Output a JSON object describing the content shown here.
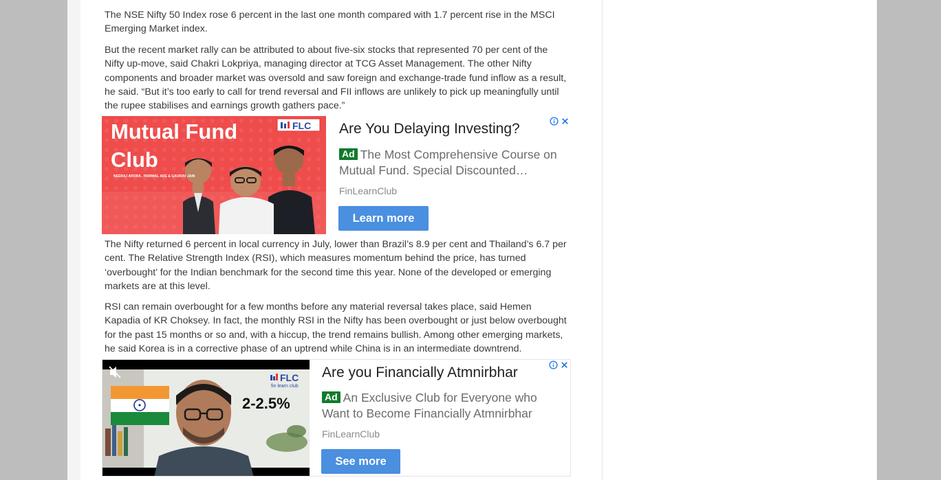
{
  "article": {
    "paragraphs": [
      "The NSE Nifty 50 Index rose 6 percent in the last one month compared with 1.7 percent rise in the MSCI Emerging Market index.",
      "But the recent market rally can be attributed to about five-six stocks that represented 70 per cent of the Nifty up-move, said Chakri Lokpriya, managing director at TCG Asset Management. The other Nifty components and broader market was oversold and saw foreign and exchange-trade fund inflow as a result, he said. “But it’s too early to call for trend reversal and FII inflows are unlikely to pick up meaningfully until the rupee stabilises and earnings growth gathers pace.”",
      "The Nifty returned 6 percent in local currency in July, lower than Brazil’s 8.9 per cent and Thailand’s 6.7 per cent. The Relative Strength Index (RSI), which measures momentum behind the price, has turned ‘overbought’ for the Indian benchmark for the second time this year. None of the developed or emerging markets are at this level.",
      "RSI can remain overbought for a few months before any material reversal takes place, said Hemen Kapadia of KR Choksey. In fact, the monthly RSI in the Nifty has been overbought or just below overbought for the past 15 months or so and, with a hiccup, the trend remains bullish. Among other emerging markets, he said Korea is in a corrective phase of an uptrend while China is in an intermediate downtrend."
    ]
  },
  "ads": [
    {
      "title": "Are You Delaying Investing?",
      "badge": "Ad",
      "description": "The Most Comprehensive Course on Mutual Fund. Special Discounted…",
      "source": "FinLearnClub",
      "cta": "Learn more",
      "image": {
        "headline_line1": "Mutual Fund",
        "headline_line2": "Club",
        "logo": "FLC",
        "names": "NEERAJ ARORA , PARIMAL ADE & GAURAV JAIN"
      }
    },
    {
      "title": "Are you Financially Atmnirbhar",
      "badge": "Ad",
      "description": "An Exclusive Club for Everyone who Want to Become Financially Atmnirbhar",
      "source": "FinLearnClub",
      "cta": "See more",
      "image": {
        "logo": "FLC",
        "logo_sub": "fin learn club",
        "stat": "2-2.5%"
      }
    }
  ],
  "colors": {
    "cta_blue": "#4a8fe0",
    "ad_badge_green": "#117a2c",
    "ad_control_blue": "#1a73e8",
    "banner_red": "#ee4a4a"
  },
  "icons": [
    "ad-info-icon",
    "ad-close-icon",
    "mute-icon",
    "india-flag-icon"
  ]
}
